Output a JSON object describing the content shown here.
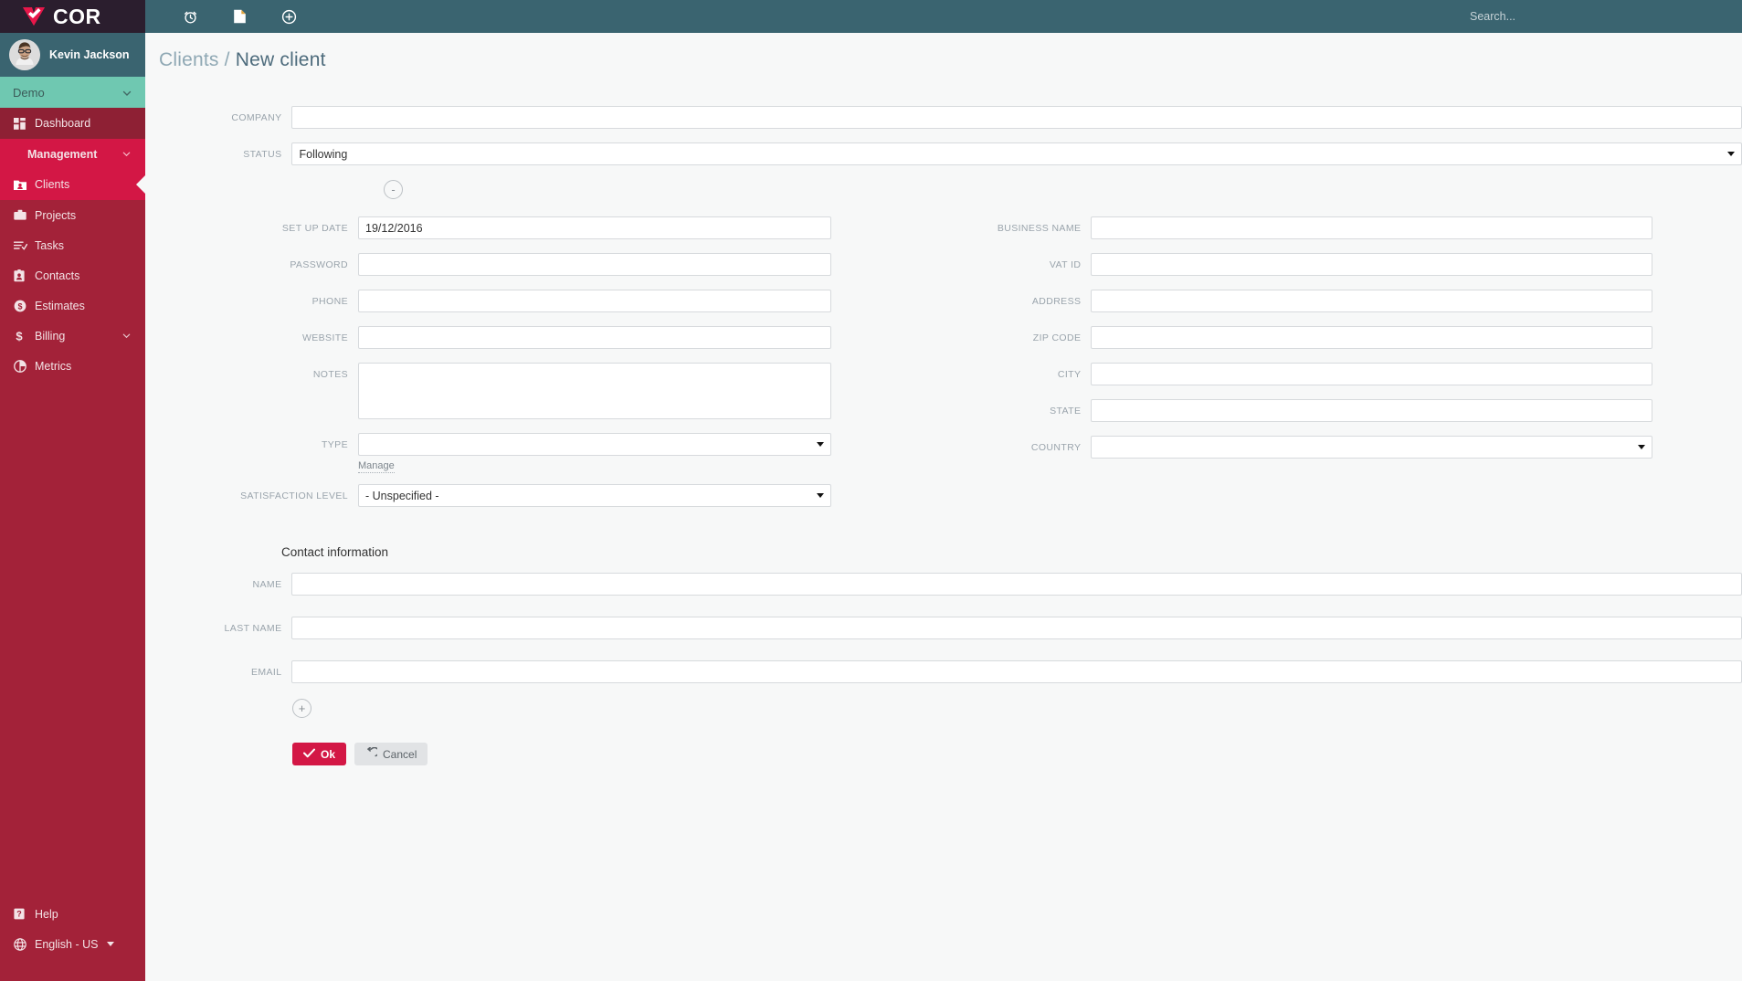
{
  "app": {
    "brand": "COR",
    "logo_icon": "heart-logo-icon"
  },
  "topbar": {
    "icons": [
      {
        "name": "alarm-clock-icon",
        "label": "Time tracking"
      },
      {
        "name": "document-icon",
        "label": "Documents"
      },
      {
        "name": "plus-circle-icon",
        "label": "Create new"
      }
    ],
    "search": {
      "placeholder": "Search...",
      "value": ""
    }
  },
  "sidebar": {
    "user": {
      "name": "Kevin Jackson",
      "avatar_icon": "user-avatar"
    },
    "workspace": {
      "label": "Demo",
      "chevron_icon": "chevron-down-icon"
    },
    "items": [
      {
        "label": "Dashboard",
        "icon": "dashboard-grid-icon",
        "state": "highlighted"
      },
      {
        "label": "Management",
        "icon": "none",
        "state": "section-open",
        "chevron_icon": "chevron-down-icon"
      },
      {
        "label": "Clients",
        "icon": "clients-card-icon",
        "state": "active"
      },
      {
        "label": "Projects",
        "icon": "briefcase-icon",
        "state": "normal"
      },
      {
        "label": "Tasks",
        "icon": "task-list-icon",
        "state": "normal"
      },
      {
        "label": "Contacts",
        "icon": "contact-card-icon",
        "state": "normal"
      },
      {
        "label": "Estimates",
        "icon": "dollar-circle-icon",
        "state": "normal"
      },
      {
        "label": "Billing",
        "icon": "dollar-sign-icon",
        "state": "normal",
        "chevron_icon": "chevron-down-icon"
      },
      {
        "label": "Metrics",
        "icon": "pie-chart-icon",
        "state": "normal"
      }
    ],
    "bottom": [
      {
        "label": "Help",
        "icon": "help-question-icon"
      },
      {
        "label": "English - US",
        "icon": "globe-icon",
        "caret_icon": "caret-down-icon"
      }
    ]
  },
  "page": {
    "breadcrumb_root": "Clients",
    "breadcrumb_sep": "/",
    "breadcrumb_current": "New client"
  },
  "form": {
    "company": {
      "label": "Company",
      "value": "",
      "placeholder": ""
    },
    "status": {
      "label": "Status",
      "value": "Following"
    },
    "collapse_toggle": {
      "label": "-",
      "name": "collapse-details-button"
    },
    "left": [
      {
        "label": "Set up date",
        "value": "19/12/2016",
        "type": "text",
        "name": "setup-date"
      },
      {
        "label": "Password",
        "value": "",
        "type": "text",
        "name": "password"
      },
      {
        "label": "Phone",
        "value": "",
        "type": "text",
        "name": "phone"
      },
      {
        "label": "Website",
        "value": "",
        "type": "text",
        "name": "website"
      },
      {
        "label": "Notes",
        "value": "",
        "type": "textarea",
        "name": "notes"
      },
      {
        "label": "Type",
        "value": "",
        "type": "select",
        "name": "type"
      },
      {
        "label": "Satisfaction level",
        "value": "- Unspecified -",
        "type": "select",
        "name": "satisfaction-level"
      }
    ],
    "manage_link": "Manage",
    "right": [
      {
        "label": "Business name",
        "value": "",
        "type": "text",
        "name": "business-name"
      },
      {
        "label": "VAT ID",
        "value": "",
        "type": "text",
        "name": "vat-id"
      },
      {
        "label": "Address",
        "value": "",
        "type": "text",
        "name": "address"
      },
      {
        "label": "Zip code",
        "value": "",
        "type": "text",
        "name": "zip-code"
      },
      {
        "label": "City",
        "value": "",
        "type": "text",
        "name": "city"
      },
      {
        "label": "State",
        "value": "",
        "type": "text",
        "name": "state"
      },
      {
        "label": "Country",
        "value": "",
        "type": "select",
        "name": "country"
      }
    ],
    "contact_section_title": "Contact information",
    "contact": [
      {
        "label": "Name",
        "value": "",
        "name": "contact-name"
      },
      {
        "label": "Last name",
        "value": "",
        "name": "contact-last-name"
      },
      {
        "label": "Email",
        "value": "",
        "name": "contact-email"
      }
    ],
    "add_contact_button": {
      "label": "+",
      "name": "add-contact-button"
    },
    "actions": {
      "ok": {
        "label": "Ok",
        "icon": "check-icon"
      },
      "cancel": {
        "label": "Cancel",
        "icon": "undo-icon"
      }
    }
  },
  "colors": {
    "brand_red": "#d31745",
    "sidebar_red": "#a32239",
    "sidebar_dark_red": "#8e2034",
    "topbar_teal": "#3a6470",
    "logo_dark": "#2b1e2e",
    "workspace_green": "#6fc8b1",
    "page_bg": "#f7f8f8",
    "label_gray": "#9aa4ac",
    "breadcrumb_gray": "#8fa8b4"
  }
}
